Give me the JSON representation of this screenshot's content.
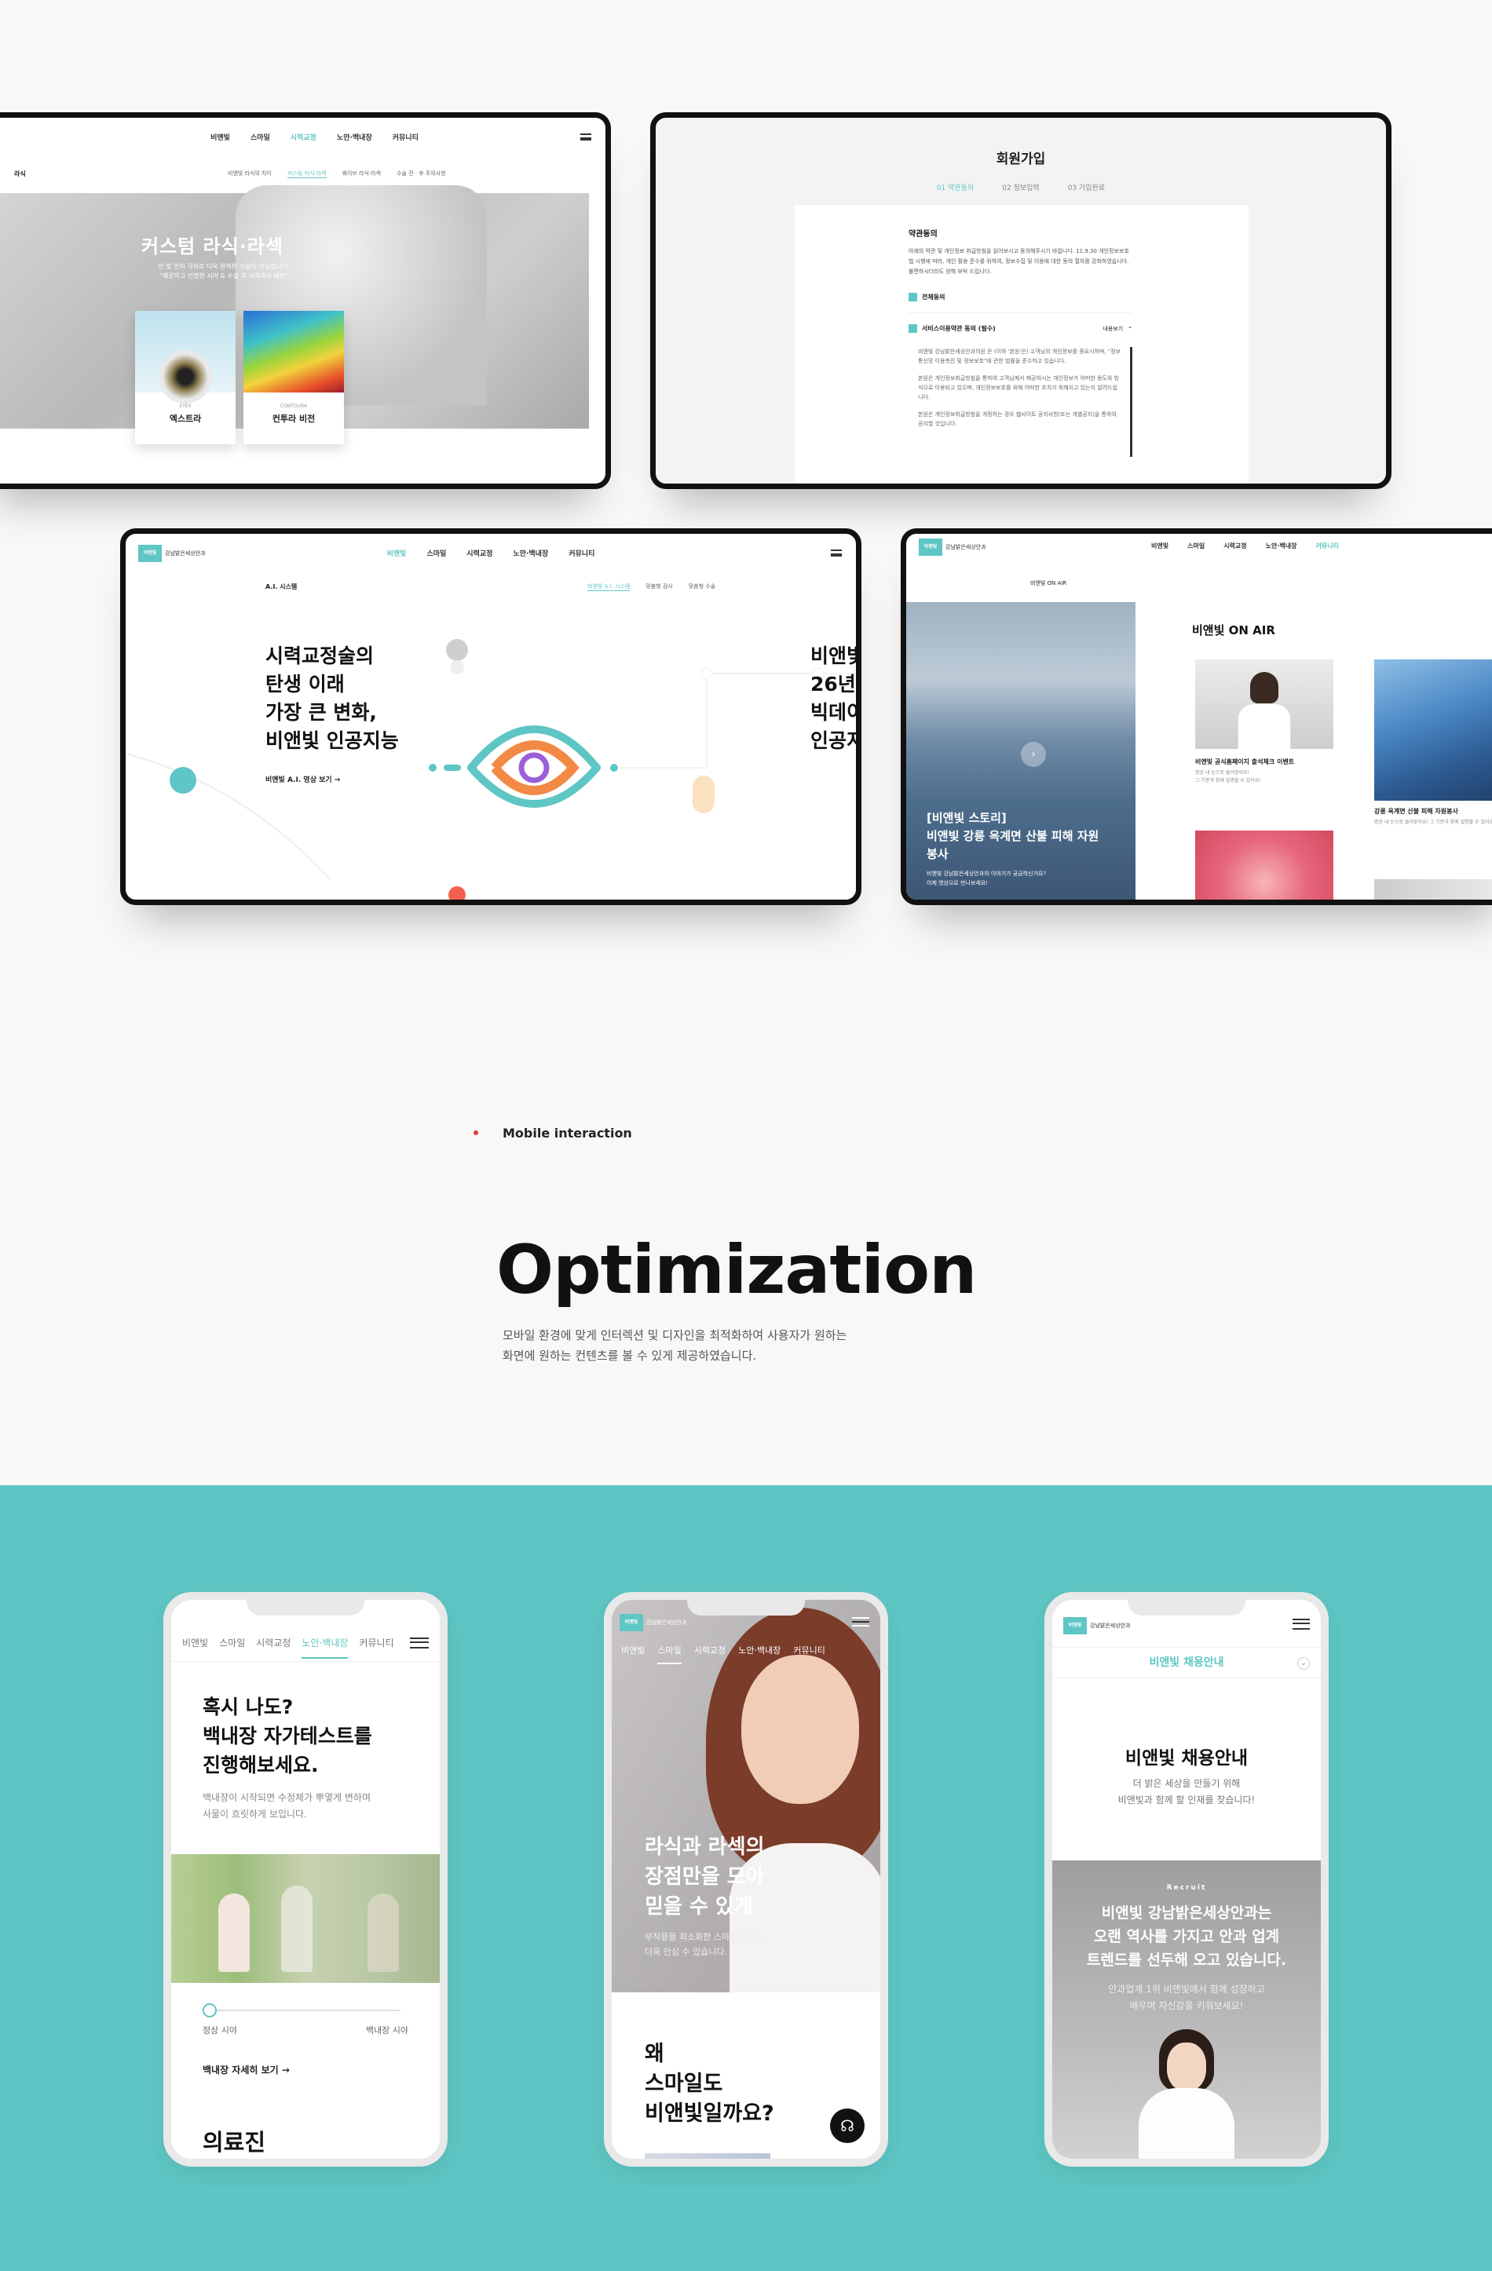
{
  "colors": {
    "teal": "#5ec6c4",
    "red": "#e53b3b",
    "dark": "#111111"
  },
  "screen1": {
    "nav": [
      "비앤빛",
      "스마일",
      "시력교정",
      "노안·백내장",
      "커뮤니티"
    ],
    "crumb": "라식",
    "sub": [
      "비앤빛 라식의 차이",
      "커스텀 라식·라섹",
      "웨이브 라식·라섹",
      "수술 전 · 후 주의사항"
    ],
    "hero_title": "커스텀 라식·라섹",
    "hero_desc1": "안 맞 안의 각자로 더욱 완벽한 수술이 가능합니다.",
    "hero_desc2": "\"깨끗하고 선명한 시야 & 수술 후 시력까지 예방\"",
    "card1_en": "EYEX",
    "card1_label": "엑스트라",
    "card2_en": "CONTOURA",
    "card2_label": "컨투라 비전"
  },
  "screen2": {
    "title": "회원가입",
    "steps": [
      "01 약관동의",
      "02 정보입력",
      "03 가입완료"
    ],
    "section": "약관동의",
    "intro": "아래의 약관 및 개인정보 취급방침을 읽어보시고 동의해주시기 바랍니다. 11.9.30 개인정보보호법 시행에 따라, 개인 활용 준수를 위하여, 정보수집 및 이용에 대한 동의 절차를 강화하였습니다. 불편하시더라도 양해 부탁 드립니다.",
    "agree_all": "전체동의",
    "agree_service": "서비스이용약관 동의 (필수)",
    "fold": "내용보기",
    "terms": [
      "비앤빛 강남밝은세상안과의원 은 (이하 '본원'은) 고객님의 개인정보를 중요시하며, \"정보통신망 이용촉진 및 정보보호\"에 관한 법률을 준수하고 있습니다.",
      "본원은 개인정보취급방침을 통하여 고객님께서 제공하시는 개인정보가 어떠한 용도와 방식으로 이용되고 있으며, 개인정보보호를 위해 어떠한 조치가 취해지고 있는지 알려드립니다.",
      "본원은 개인정보취급방침을 개정하는 경우 웹사이트 공지사항(또는 개별공지)을 통하여 공지할 것입니다."
    ]
  },
  "screen3": {
    "logo": "강남밝은세상안과",
    "logo_mark": "비앤빛",
    "nav": [
      "비앤빛",
      "스마일",
      "시력교정",
      "노안·백내장",
      "커뮤니티"
    ],
    "crumb": "A.I. 시스템",
    "sub": [
      "비앤빛 A.I. 시스템",
      "맞춤형 검사",
      "맞춤형 수술"
    ],
    "headline": [
      "시력교정술의",
      "탄생 이래",
      "가장 큰 변화,",
      "비앤빛 인공지능"
    ],
    "link": "비앤빛 A.I. 영상 보기 →",
    "partial": [
      "비앤빛",
      "26년",
      "빅데이",
      "인공지"
    ]
  },
  "screen4": {
    "logo": "강남밝은세상안과",
    "logo_mark": "비앤빛",
    "nav": [
      "비앤빛",
      "스마일",
      "시력교정",
      "노안·백내장",
      "커뮤니티"
    ],
    "crumb": "비앤빛 ON AIR",
    "feature_title": "[비앤빛 스토리]\n비앤빛 강릉 옥계면 산불 피해 자원봉사",
    "feature_desc": "비앤빛 강남밝은세상안과의 이야기가 궁금하신가요?\n이제 영상으로 만나보세요!",
    "section_title": "비앤빛 ON AIR",
    "item1_title": "비앤빛 공식홈페이지 출석체크 이벤트",
    "item1_desc": "명상 내 눈으로 들어맞아요!\n그 기분과 함께 설명할 수 있어요!",
    "item2_title": "강릉 옥계면 산불 피해 자원봉사",
    "item2_desc": "명상 내 눈으로 들어맞아요! 그 기분과 함께 설명할 수 있어요!"
  },
  "section": {
    "label": "Mobile interaction",
    "title": "Optimization",
    "desc1": "모바일 환경에 맞게 인터렉션 및 디자인을 최적화하여 사용자가 원하는",
    "desc2": "화면에 원하는 컨텐츠를 볼 수 있게 제공하였습니다."
  },
  "m1": {
    "nav": [
      "비앤빛",
      "스마일",
      "시력교정",
      "노안·백내장",
      "커뮤니티"
    ],
    "title": [
      "혹시 나도?",
      "백내장 자가테스트를",
      "진행해보세요."
    ],
    "desc": [
      "백내장이 시작되면 수정체가 뿌옇게 변하며",
      "사물이 흐릿하게 보입니다."
    ],
    "slider_left": "정상 시야",
    "slider_right": "백내장 시야",
    "link": "백내장 자세히 보기 →",
    "footer_title": "의료진"
  },
  "m2": {
    "logo": "강남밝은세상안과",
    "logo_mark": "비앤빛",
    "nav": [
      "비앤빛",
      "스마일",
      "시력교정",
      "노안·백내장",
      "커뮤니티"
    ],
    "hero": [
      "라식과 라섹의",
      "장점만을 모아",
      "믿을 수 있게"
    ],
    "hero_desc": [
      "부작용을 최소화한 스마일라식은",
      "더욱 안심 수 있습니다."
    ],
    "question": [
      "왜",
      "스마일도",
      "비앤빛일까요?"
    ]
  },
  "m3": {
    "logo": "강남밝은세상안과",
    "logo_mark": "비앤빛",
    "select": "비앤빛 채용안내",
    "title": "비앤빛 채용안내",
    "desc": [
      "더 밝은 세상을 만들기 위해",
      "비앤빛과 함께 할 인재를 찾습니다!"
    ],
    "recruit": "Recruit",
    "headline": [
      "비앤빛 강남밝은세상안과는",
      "오랜 역사를 가지고 안과 업계",
      "트렌드를 선두해 오고 있습니다."
    ],
    "sub": [
      "안과업계 1위 비앤빛에서 함께 성장하고",
      "배우며 자신감을 키워보세요!"
    ]
  }
}
